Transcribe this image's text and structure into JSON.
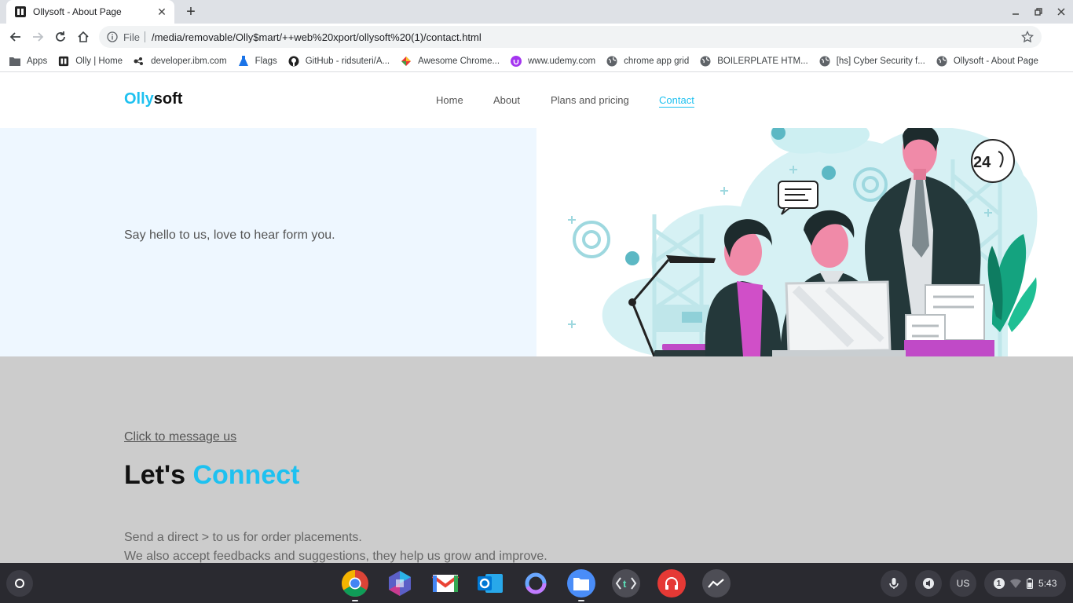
{
  "browser": {
    "tab_title": "Ollysoft - About Page",
    "url_scheme": "File",
    "url": "/media/removable/Olly$mart/++web%20xport/ollysoft%20(1)/contact.html",
    "bookmarks": [
      {
        "label": "Apps",
        "icon": "apps-folder-icon"
      },
      {
        "label": "Olly | Home",
        "icon": "olly-favicon"
      },
      {
        "label": "developer.ibm.com",
        "icon": "ibm-developer-icon"
      },
      {
        "label": "Flags",
        "icon": "flask-icon"
      },
      {
        "label": "GitHub - ridsuteri/A...",
        "icon": "github-icon"
      },
      {
        "label": "Awesome Chrome...",
        "icon": "awesome-chrome-icon"
      },
      {
        "label": "www.udemy.com",
        "icon": "udemy-icon"
      },
      {
        "label": "chrome app grid",
        "icon": "globe-icon"
      },
      {
        "label": "BOILERPLATE HTM...",
        "icon": "globe-icon"
      },
      {
        "label": "[hs] Cyber Security f...",
        "icon": "globe-icon"
      },
      {
        "label": "Ollysoft - About Page",
        "icon": "globe-icon"
      }
    ]
  },
  "site": {
    "logo_accent": "Olly",
    "logo_rest": "soft",
    "nav": [
      "Home",
      "About",
      "Plans and pricing",
      "Contact"
    ],
    "active_nav": "Contact",
    "hero_tagline": "Say hello to us, love to hear form you.",
    "message_link": "Click to message us",
    "connect_title_plain": "Let's",
    "connect_title_accent": "Connect",
    "connect_line1": "Send a direct > to us for order placements.",
    "connect_line2": "We also accept feedbacks and suggestions, they help us grow and improve.",
    "hero_badge": "24"
  },
  "shelf": {
    "apps": [
      "chrome-icon",
      "microsoft-365-icon",
      "gmail-icon",
      "outlook-icon",
      "circle-app-icon",
      "files-icon",
      "text-editor-icon",
      "headphones-app-icon",
      "analytics-app-icon"
    ],
    "keyboard_layout": "US",
    "notification_count": "1",
    "time": "5:43"
  },
  "colors": {
    "accent": "#1ec1f0",
    "hero_left_bg": "#eef7ff",
    "connect_bg": "#cccccc",
    "shelf_bg": "#2a2a30"
  }
}
